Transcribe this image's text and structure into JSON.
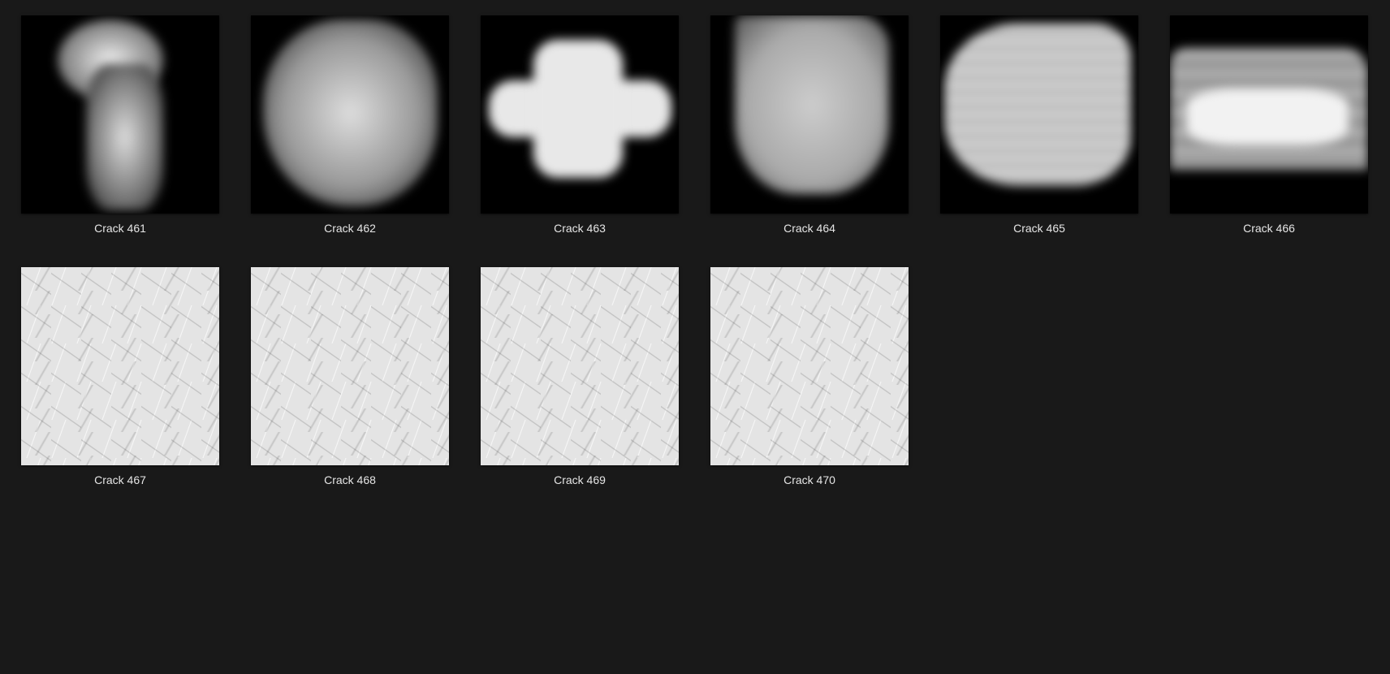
{
  "items": [
    {
      "label": "Crack 461"
    },
    {
      "label": "Crack 462"
    },
    {
      "label": "Crack 463"
    },
    {
      "label": "Crack 464"
    },
    {
      "label": "Crack 465"
    },
    {
      "label": "Crack 466"
    },
    {
      "label": "Crack 467"
    },
    {
      "label": "Crack 468"
    },
    {
      "label": "Crack 469"
    },
    {
      "label": "Crack 470"
    }
  ]
}
